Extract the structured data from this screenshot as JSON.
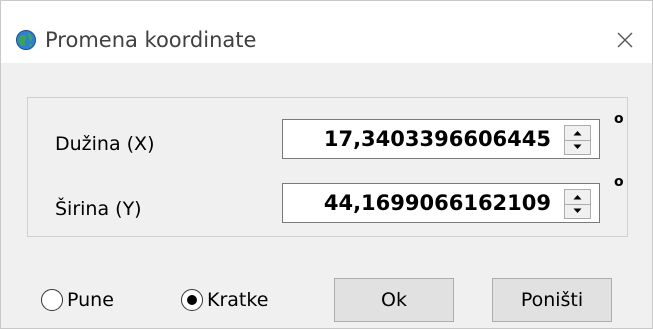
{
  "window": {
    "title": "Promena koordinate",
    "app_icon": "globe-icon",
    "close_icon": "close-icon"
  },
  "fields": [
    {
      "label": "Dužina (X)",
      "value": "17,3403396606445",
      "unit": "o"
    },
    {
      "label": "Širina (Y)",
      "value": "44,1699066162109",
      "unit": "o"
    }
  ],
  "format": {
    "options": [
      {
        "label": "Pune",
        "selected": false
      },
      {
        "label": "Kratke",
        "selected": true
      }
    ]
  },
  "buttons": {
    "ok": "Ok",
    "cancel": "Poništi"
  },
  "colors": {
    "window_bg": "#f0f0f0",
    "titlebar_bg": "#ffffff",
    "button_bg": "#e1e1e1"
  }
}
